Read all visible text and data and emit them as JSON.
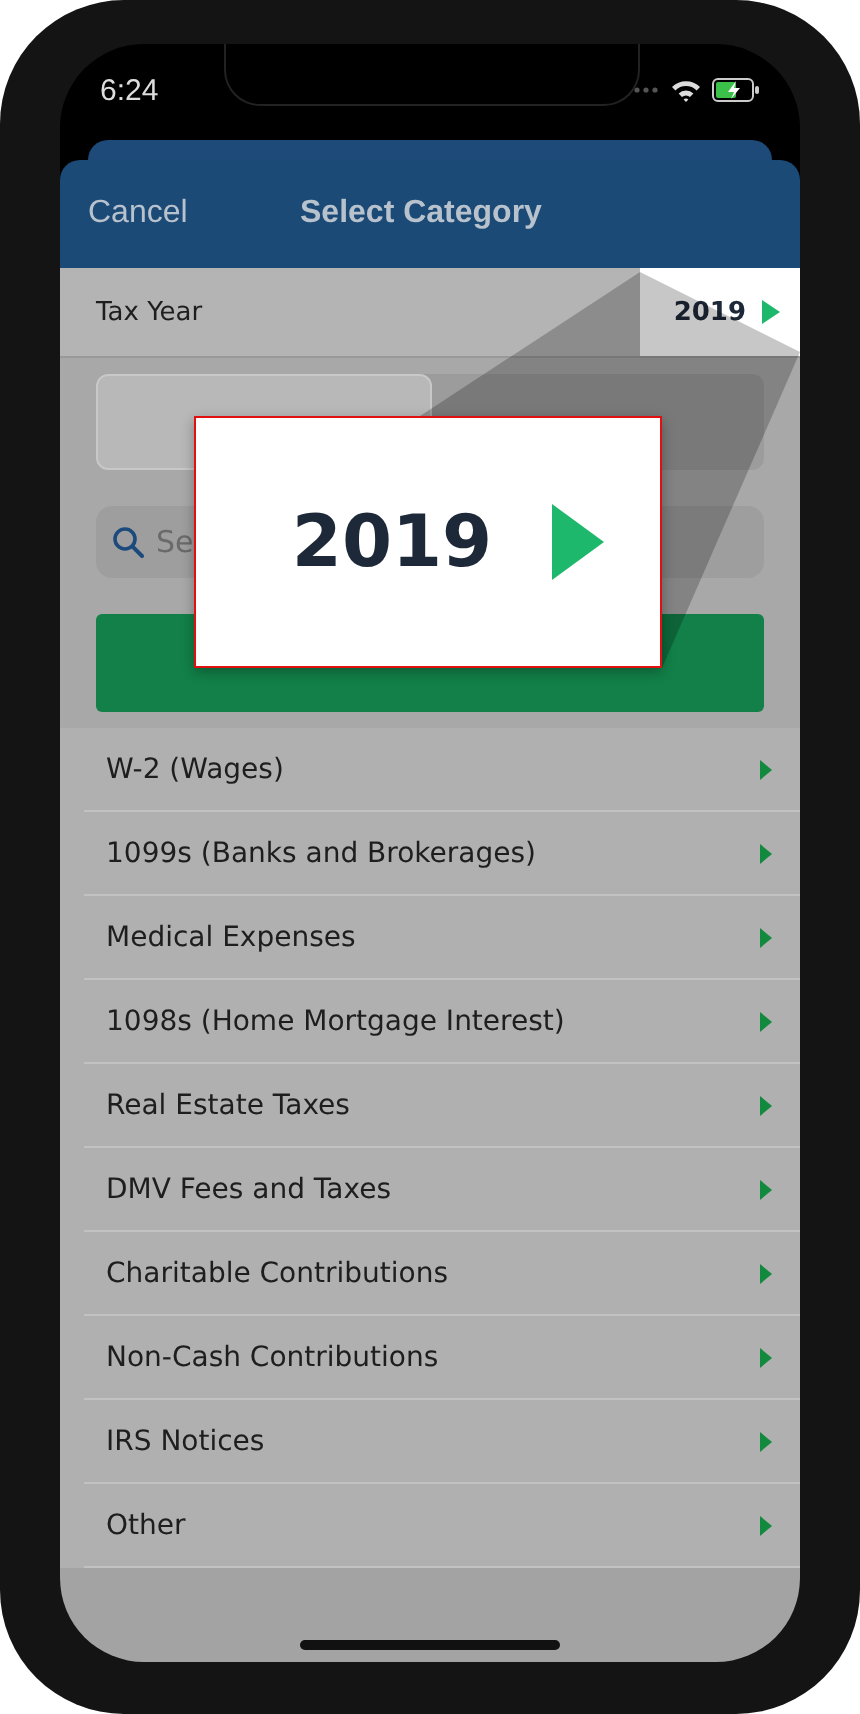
{
  "status_bar": {
    "time": "6:24",
    "charging": true
  },
  "header": {
    "cancel": "Cancel",
    "title": "Select Category"
  },
  "tax_year": {
    "label": "Tax Year",
    "value": "2019"
  },
  "search": {
    "placeholder": "Se"
  },
  "categories": [
    {
      "label": "W-2 (Wages)"
    },
    {
      "label": "1099s (Banks and Brokerages)"
    },
    {
      "label": "Medical Expenses"
    },
    {
      "label": "1098s (Home Mortgage Interest)"
    },
    {
      "label": "Real Estate Taxes"
    },
    {
      "label": "DMV Fees and Taxes"
    },
    {
      "label": "Charitable Contributions"
    },
    {
      "label": "Non-Cash Contributions"
    },
    {
      "label": "IRS Notices"
    },
    {
      "label": "Other"
    }
  ],
  "callout": {
    "value": "2019"
  }
}
